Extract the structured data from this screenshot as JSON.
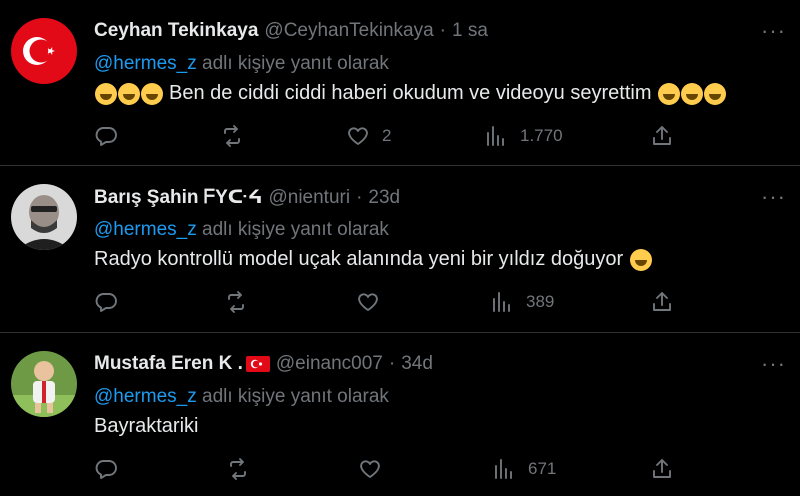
{
  "tweets": [
    {
      "name": "Ceyhan Tekinkaya",
      "handle": "@CeyhanTekinkaya",
      "time": "1 sa",
      "mention": "@hermes_z",
      "reply_suffix": "adlı kişiye yanıt olarak",
      "text": "Ben de ciddi ciddi haberi okudum ve videoyu seyrettim",
      "likes": "2",
      "views": "1.770"
    },
    {
      "name": "Barış Şahin ᖴYᑢᔦ",
      "handle": "@nienturi",
      "time": "23d",
      "mention": "@hermes_z",
      "reply_suffix": "adlı kişiye yanıt olarak",
      "text": "Radyo kontrollü model uçak alanında yeni bir yıldız doğuyor",
      "likes": "",
      "views": "389"
    },
    {
      "name": "Mustafa Eren K .",
      "handle": "@einanc007",
      "time": "34d",
      "mention": "@hermes_z",
      "reply_suffix": "adlı kişiye yanıt olarak",
      "text": "Bayraktariki",
      "likes": "",
      "views": "671"
    }
  ],
  "separator": "·",
  "more_glyph": "···",
  "colors": {
    "background": "#000000",
    "text": "#e7e9ea",
    "muted": "#71767b",
    "link": "#1d9bf0",
    "divider": "#2f3336"
  }
}
